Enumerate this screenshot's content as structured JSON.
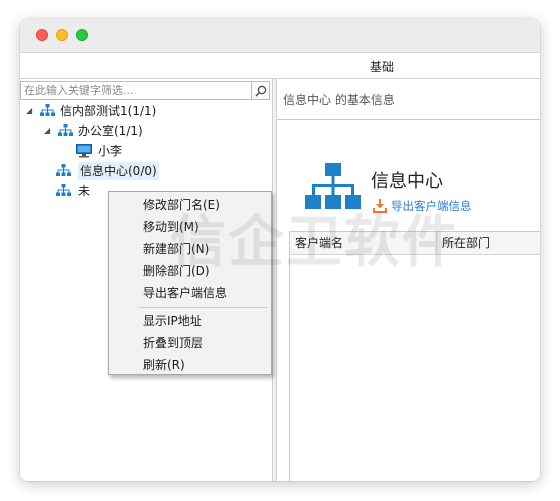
{
  "ribbon": {
    "tab_label": "基础"
  },
  "filter": {
    "placeholder": "在此输入关键字筛选..."
  },
  "tree": {
    "nodes": [
      {
        "label": "信内部测试1(1/1)"
      },
      {
        "label": "办公室(1/1)"
      },
      {
        "label": "小李"
      },
      {
        "label": "信息中心(0/0)"
      },
      {
        "label": "未"
      }
    ]
  },
  "context_menu": {
    "items": [
      {
        "label": "修改部门名(E)"
      },
      {
        "label": "移动到(M)"
      },
      {
        "label": "新建部门(N)"
      },
      {
        "label": "删除部门(D)"
      },
      {
        "label": "导出客户端信息"
      },
      {
        "label": "显示IP地址"
      },
      {
        "label": "折叠到顶层"
      },
      {
        "label": "刷新(R)"
      }
    ]
  },
  "detail": {
    "breadcrumb": "信息中心 的基本信息",
    "title": "信息中心",
    "export_link": "导出客户端信息"
  },
  "table": {
    "columns": [
      "客户端名",
      "所在部门"
    ],
    "rows": []
  },
  "watermark": "信企卫软件",
  "colors": {
    "accent": "#1f7fc9",
    "link": "#2b7bd0",
    "export_icon": "#e9783a",
    "traffic_red": "#fe5f57",
    "traffic_yellow": "#febc2e",
    "traffic_green": "#28c840"
  },
  "icons": {
    "search": "search-icon",
    "org": "org-tree-icon",
    "computer": "computer-icon",
    "export": "download-icon"
  }
}
